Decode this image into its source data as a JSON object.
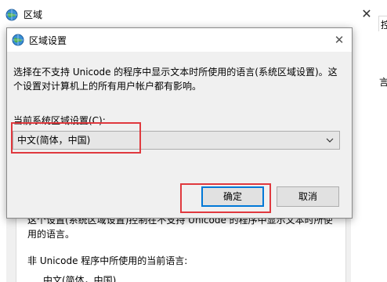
{
  "background_window": {
    "title": "区域",
    "close_glyph": "✕",
    "tab_fragment": "控",
    "right_fragment": "言",
    "group_text": "这个设置(系统区域设置)控制在不支持 Unicode 的程序中显示文本时所使用的语言。",
    "current_lang_label": "非 Unicode 程序中所使用的当前语言:",
    "current_lang_value": "中文(简体，中国)"
  },
  "dialog": {
    "title": "区域设置",
    "close_glyph": "✕",
    "description": "选择在不支持 Unicode 的程序中显示文本时所使用的语言(系统区域设置)。这个设置对计算机上的所有用户帐户都有影响。",
    "locale_label": "当前系统区域设置(C):",
    "locale_value": "中文(简体，中国)",
    "ok_label": "确定",
    "cancel_label": "取消"
  },
  "icons": {
    "window_icon": "globe-icon",
    "dropdown_icon": "chevron-down-icon",
    "close_icon": "close-icon"
  },
  "colors": {
    "highlight": "#e0393e",
    "focus_blue": "#0078d7",
    "dialog_bg": "#f0f0f0"
  }
}
